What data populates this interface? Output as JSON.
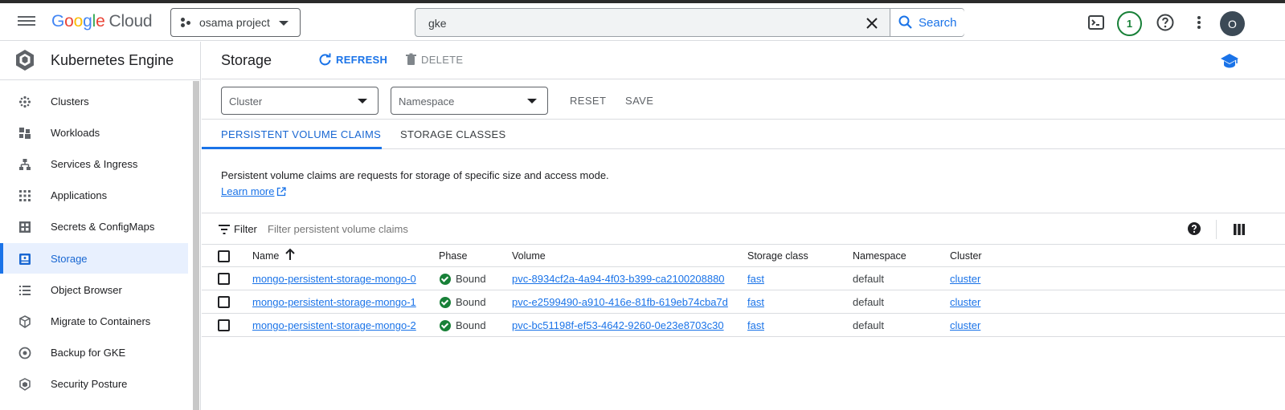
{
  "topbar": {
    "logo_google": "Google",
    "logo_cloud": "Cloud",
    "project": "osama project",
    "search_value": "gke",
    "search_button": "Search",
    "notification_count": "1",
    "avatar_initial": "O"
  },
  "colors": {
    "accent": "#1a73e8",
    "success": "#188038",
    "active_bg": "#e8f0fe"
  },
  "sidebar": {
    "title": "Kubernetes Engine",
    "items": [
      {
        "label": "Clusters",
        "icon": "clusters-icon"
      },
      {
        "label": "Workloads",
        "icon": "workloads-icon"
      },
      {
        "label": "Services & Ingress",
        "icon": "services-icon"
      },
      {
        "label": "Applications",
        "icon": "applications-icon"
      },
      {
        "label": "Secrets & ConfigMaps",
        "icon": "secrets-icon"
      },
      {
        "label": "Storage",
        "icon": "storage-icon"
      },
      {
        "label": "Object Browser",
        "icon": "object-browser-icon"
      },
      {
        "label": "Migrate to Containers",
        "icon": "migrate-icon"
      },
      {
        "label": "Backup for GKE",
        "icon": "backup-icon"
      },
      {
        "label": "Security Posture",
        "icon": "security-icon"
      }
    ],
    "active": "Storage"
  },
  "page": {
    "title": "Storage",
    "refresh_label": "REFRESH",
    "delete_label": "DELETE"
  },
  "filters": {
    "cluster_placeholder": "Cluster",
    "namespace_placeholder": "Namespace",
    "reset_label": "RESET",
    "save_label": "SAVE"
  },
  "tabs": [
    {
      "label": "PERSISTENT VOLUME CLAIMS",
      "active": true
    },
    {
      "label": "STORAGE CLASSES",
      "active": false
    }
  ],
  "description": "Persistent volume claims are requests for storage of specific size and access mode.",
  "learn_more": "Learn more",
  "filter_bar": {
    "label": "Filter",
    "placeholder": "Filter persistent volume claims"
  },
  "table": {
    "columns": [
      "Name",
      "Phase",
      "Volume",
      "Storage class",
      "Namespace",
      "Cluster"
    ],
    "sort_column": "Name",
    "rows": [
      {
        "name": "mongo-persistent-storage-mongo-0",
        "phase": "Bound",
        "volume": "pvc-8934cf2a-4a94-4f03-b399-ca2100208880",
        "storage_class": "fast",
        "namespace": "default",
        "cluster": "cluster"
      },
      {
        "name": "mongo-persistent-storage-mongo-1",
        "phase": "Bound",
        "volume": "pvc-e2599490-a910-416e-81fb-619eb74cba7d",
        "storage_class": "fast",
        "namespace": "default",
        "cluster": "cluster"
      },
      {
        "name": "mongo-persistent-storage-mongo-2",
        "phase": "Bound",
        "volume": "pvc-bc51198f-ef53-4642-9260-0e23e8703c30",
        "storage_class": "fast",
        "namespace": "default",
        "cluster": "cluster"
      }
    ]
  }
}
